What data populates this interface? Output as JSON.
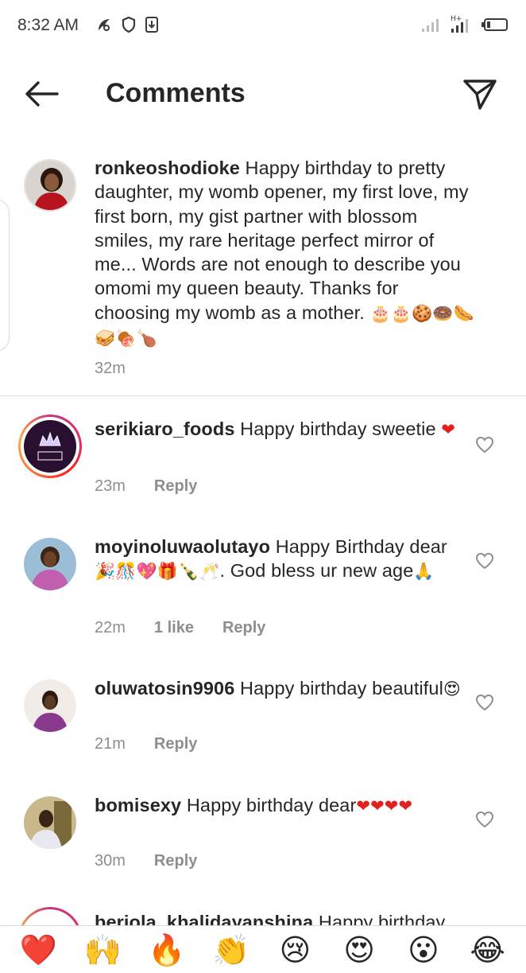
{
  "status_bar": {
    "time": "8:32 AM"
  },
  "header": {
    "title": "Comments"
  },
  "caption": {
    "username": "ronkeoshodioke",
    "text": "Happy birthday to pretty daughter, my womb opener, my first love, my first born, my gist partner with blossom smiles, my rare heritage perfect mirror of me... Words are not enough to describe you omomi my queen beauty. Thanks for choosing my womb as a mother.",
    "emojis": "🎂🎂🍪🍩🌭🥪🍖🍗",
    "time": "32m"
  },
  "comments": [
    {
      "username": "serikiaro_foods",
      "text": "Happy birthday sweetie",
      "emojis": "❤",
      "time": "23m",
      "reply": "Reply",
      "avatar_label": "SERIKI"
    },
    {
      "username": "moyinoluwaolutayo",
      "text_a": "Happy Birthday dear",
      "emojis_a": "🎉🎊💖🎁🍾🥂",
      "text_b": ". God bless ur new age",
      "emojis_b": "🙏",
      "time": "22m",
      "likes": "1 like",
      "reply": "Reply"
    },
    {
      "username": "oluwatosin9906",
      "text": "Happy birthday beautiful",
      "emojis": "😍",
      "time": "21m",
      "reply": "Reply"
    },
    {
      "username": "bomisexy",
      "text": "Happy birthday dear",
      "emojis": "❤❤❤❤",
      "time": "30m",
      "reply": "Reply"
    },
    {
      "username": "beriola_khalidayanshina",
      "text": "Happy birthday"
    }
  ],
  "emoji_bar": [
    "❤️",
    "🙌",
    "🔥",
    "👏",
    "😢",
    "😍",
    "😮",
    "😂"
  ],
  "colors": {
    "text": "#262626",
    "meta": "#8e8e8e",
    "heart": "#e0211d",
    "divider": "#dbdbdb"
  }
}
